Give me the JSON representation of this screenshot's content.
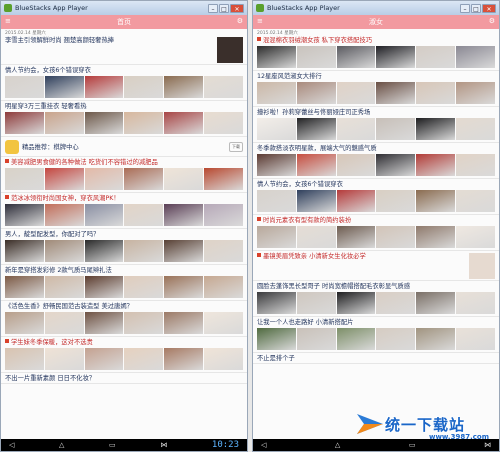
{
  "windows": [
    {
      "titlebar": {
        "title": "BlueStacks App Player",
        "minimize": "–",
        "maximize": "□",
        "close": "✕"
      },
      "header": {
        "title": "首页",
        "left": "≡",
        "right": "⚙"
      },
      "date": "2015.02.14 星期六",
      "items": [
        {
          "title": "李雪主引领解鲜时尚 翘楚高颜轻奢热捧",
          "photos": [
            "#c9b7a2",
            "#3a2f2b",
            "#d8cfc6",
            "#7e6a5a"
          ],
          "meta_left": "",
          "meta_right": "",
          "big": true,
          "navy": true
        },
        {
          "title": "情人节约会，女孩6个错误穿衣",
          "photos": [
            "#d8d2cc",
            "#2f3f5c",
            "#b53a3a",
            "#d9cfc3",
            "#8a6b4f",
            "#e4dcd3"
          ],
          "meta_left": "",
          "meta_right": "",
          "navy": true
        },
        {
          "title": "明星穿3万三重挂衣 轻奢看热",
          "photos": [
            "#8e3b3b",
            "#c9a38b",
            "#6d5849",
            "#d7b79d",
            "#a84545",
            "#e8dcd0"
          ],
          "meta_left": "",
          "meta_right": "",
          "navy": true
        },
        {
          "app": true,
          "title": "精品推荐：棋牌中心",
          "sub": "",
          "dl": "下载"
        },
        {
          "title": "美容减肥男食健的各种做法 吃货们不容错过的减肥品",
          "photos": [
            "#d9d2c8",
            "#c5463f",
            "#e3b9a7",
            "#aa6c55",
            "#efe4d8",
            "#b8482f"
          ],
          "meta_left": "",
          "meta_right": "",
          "flag": true
        },
        {
          "title": "范冰冰领衔时尚国女神，穿衣风潮PK！",
          "photos": [
            "#2e2e3a",
            "#c26e5a",
            "#8a8fa3",
            "#e2d4c7",
            "#5a3e55",
            "#b6a8b8"
          ],
          "meta_left": "",
          "meta_right": "",
          "flag": true
        },
        {
          "title": "男人，靛型配发型，你配对了吗？",
          "photos": [
            "#3b2e27",
            "#a08a78",
            "#2a2a2a",
            "#c7b3a1",
            "#584034",
            "#dfd3c7"
          ],
          "meta_left": "",
          "meta_right": "",
          "navy": true
        },
        {
          "title": "新年是穿搭发彩修 2款气质马尾辫扎法",
          "photos": [
            "#7d5a45",
            "#cfb9a6",
            "#5d3d2f",
            "#e0cdbd",
            "#9a7258",
            "#c6a891"
          ],
          "meta_left": "",
          "meta_right": "",
          "navy": true
        },
        {
          "title": "《活色生香》舒畅民国范古装造型 美过唐嫣？",
          "photos": [
            "#b79e8a",
            "#e4d6c9",
            "#6f5243",
            "#d3c0b0",
            "#9c7a66",
            "#efe6dc"
          ],
          "meta_left": "",
          "meta_right": "",
          "navy": true
        },
        {
          "title": "学生妹冬季保暖，这对不选贵",
          "photos": [
            "#d9c3b0",
            "#efe2d5",
            "#c4a190",
            "#e6d1bf",
            "#a77a63",
            "#f0e4d8"
          ],
          "meta_left": "",
          "meta_right": "",
          "flag": true
        },
        {
          "title": "不出一片重新素颜 日日不化妆？",
          "photos": [],
          "meta_left": "",
          "meta_right": "",
          "navy": true
        }
      ],
      "navbar": {
        "back": "◁",
        "home": "△",
        "recent": "▭",
        "share": "⋈",
        "clock": "10:23"
      }
    },
    {
      "titlebar": {
        "title": "BlueStacks App Player",
        "minimize": "–",
        "maximize": "□",
        "close": "✕"
      },
      "header": {
        "title": "淑女",
        "left": "≡",
        "right": "⚙"
      },
      "date": "2015.02.14 星期六",
      "items": [
        {
          "title": "混混棉衣羽绒潮女孩 私下穿衣搭配技巧",
          "photos": [
            "#2c2c2c",
            "#c9c3bd",
            "#5a5a60",
            "#1f1f24",
            "#d4ccc5",
            "#8a8893"
          ],
          "meta_left": "",
          "meta_right": "",
          "flag": true
        },
        {
          "title": "12星座风范淑女大排行",
          "photos": [
            "#cbb7a6",
            "#a98a7c",
            "#e0d2c6",
            "#6a4f44",
            "#d8c6b7",
            "#b29583"
          ],
          "meta_left": "",
          "meta_right": "",
          "navy": true
        },
        {
          "title": "撞衫啦！孙莉穿蕾丝与佟丽娅庄司正秀场",
          "photos": [
            "#f3eee9",
            "#222224",
            "#e8e0d8",
            "#c7bfb8",
            "#1d1d1f",
            "#e4dad0"
          ],
          "meta_left": "",
          "meta_right": "",
          "navy": true
        },
        {
          "title": "冬季款搭淡衣明星款，展端大气的魅惑气质",
          "photos": [
            "#5b3a32",
            "#c64d3f",
            "#d8c7b8",
            "#2f2e33",
            "#b23b36",
            "#e1d3c6"
          ],
          "meta_left": "",
          "meta_right": "",
          "navy": true
        },
        {
          "title": "情人节约会，女孩6个错误穿衣",
          "photos": [
            "#d8d2cc",
            "#2f3f5c",
            "#b53a3a",
            "#d9cfc3",
            "#8a6b4f",
            "#e4dcd3"
          ],
          "meta_left": "",
          "meta_right": "",
          "navy": true
        },
        {
          "title": "时尚元素衣有型有款的简约装扮",
          "photos": [
            "#b8a89b",
            "#e5ddd5",
            "#6e5c50",
            "#d2c4b8",
            "#8f7a6c",
            "#efe8e1"
          ],
          "meta_left": "",
          "meta_right": "",
          "flag": true
        },
        {
          "title": "墨镜美眉凭致亲 小清新女生化妆必学",
          "photos": [
            "#e6dad0"
          ],
          "meta_left": "",
          "meta_right": "",
          "big": true,
          "flag": true
        },
        {
          "title": "圆脸去蓬饰黑长型哥子 时尚宽檐帽搭配毛衣彰显气质感",
          "photos": [
            "#3a3a3c",
            "#cfc7bf",
            "#1e1e20",
            "#d9cec4",
            "#7a6f66",
            "#e8e0d8"
          ],
          "meta_left": "",
          "meta_right": "",
          "navy": true
        },
        {
          "title": "让我一个人也走路好 小清新搭配片",
          "photos": [
            "#4f6a3f",
            "#c9c1b9",
            "#7d8f68",
            "#d6ccc2",
            "#a19480",
            "#e9e1d9"
          ],
          "meta_left": "",
          "meta_right": "",
          "navy": true
        },
        {
          "title": "不止是排个子",
          "photos": [],
          "meta_left": "",
          "meta_right": "",
          "navy": true
        }
      ],
      "navbar": {
        "back": "◁",
        "home": "△",
        "recent": "▭",
        "share": "⋈",
        "clock": ""
      }
    }
  ],
  "watermark": {
    "text": "统一下载站",
    "url": "www.3987.com"
  },
  "colors": {
    "header": "#f29aa0",
    "title_red": "#c42a2a",
    "title_navy": "#23355d",
    "clock": "#5db5ff"
  }
}
